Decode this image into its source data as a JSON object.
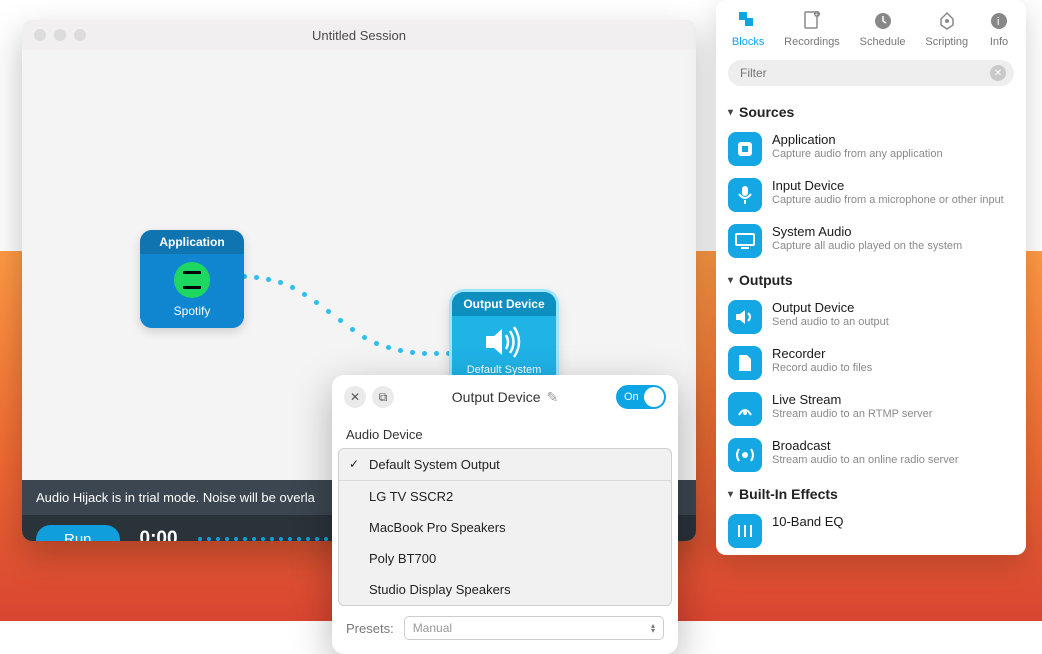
{
  "window": {
    "title": "Untitled Session"
  },
  "blocks": {
    "app": {
      "label": "Application",
      "name": "Spotify"
    },
    "out": {
      "label": "Output Device",
      "name": "Default System Output"
    }
  },
  "trialbar": {
    "text": "Audio Hijack is in trial mode. Noise will be overla"
  },
  "bottom": {
    "run": "Run",
    "time": "0:00",
    "pct": "%"
  },
  "popover": {
    "title": "Output Device",
    "toggle": "On",
    "section": "Audio Device",
    "options": {
      "o0": "Default System Output",
      "o1": "LG TV SSCR2",
      "o2": "MacBook Pro Speakers",
      "o3": "Poly BT700",
      "o4": "Studio Display Speakers"
    },
    "presets_label": "Presets:",
    "presets_value": "Manual"
  },
  "library": {
    "tabs": {
      "blocks": "Blocks",
      "recordings": "Recordings",
      "schedule": "Schedule",
      "scripting": "Scripting",
      "info": "Info"
    },
    "filter_placeholder": "Filter",
    "groups": {
      "sources": "Sources",
      "outputs": "Outputs",
      "effects": "Built-In Effects"
    },
    "items": {
      "application": {
        "t": "Application",
        "d": "Capture audio from any application"
      },
      "input": {
        "t": "Input Device",
        "d": "Capture audio from a microphone or other input"
      },
      "sysaudio": {
        "t": "System Audio",
        "d": "Capture all audio played on the system"
      },
      "outputdev": {
        "t": "Output Device",
        "d": "Send audio to an output"
      },
      "recorder": {
        "t": "Recorder",
        "d": "Record audio to files"
      },
      "livestream": {
        "t": "Live Stream",
        "d": "Stream audio to an RTMP server"
      },
      "broadcast": {
        "t": "Broadcast",
        "d": "Stream audio to an online radio server"
      },
      "eq": {
        "t": "10-Band EQ",
        "d": ""
      }
    }
  }
}
